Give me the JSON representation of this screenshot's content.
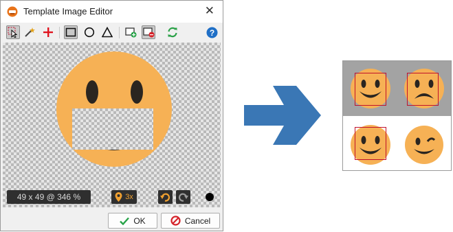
{
  "window": {
    "title": "Template Image Editor",
    "close_icon": "close-icon",
    "app_icon": "app-logo-icon"
  },
  "toolbar": {
    "tools": [
      {
        "icon": "select-cursor-icon",
        "active": true
      },
      {
        "icon": "magic-wand-icon",
        "active": false
      },
      {
        "icon": "add-point-icon",
        "active": false
      },
      {
        "icon": "rectangle-shape-icon",
        "active": true
      },
      {
        "icon": "circle-shape-icon",
        "active": false
      },
      {
        "icon": "triangle-shape-icon",
        "active": false
      },
      {
        "icon": "add-region-icon",
        "active": false
      },
      {
        "icon": "remove-region-icon",
        "active": true
      },
      {
        "icon": "refresh-icon",
        "active": false
      },
      {
        "icon": "help-icon",
        "active": false
      }
    ]
  },
  "canvas": {
    "info": "49 x 49 @ 346 %",
    "pin_label": "3x",
    "undo_icon": "undo-icon",
    "redo_icon": "redo-icon",
    "color_icon": "color-swatch-icon"
  },
  "buttons": {
    "ok_label": "OK",
    "cancel_label": "Cancel"
  },
  "colors": {
    "face": "#f6b155",
    "accent_blue": "#3a77b5",
    "roi_red": "#c0102a",
    "checker_dark": "#b9b9b9",
    "checker_light": "#e6e6e6"
  },
  "result_preview": {
    "faces": [
      "smiling-face-icon",
      "frowning-face-icon",
      "smiling-face-icon",
      "winking-face-icon"
    ],
    "matched": [
      true,
      true,
      true,
      false
    ]
  }
}
